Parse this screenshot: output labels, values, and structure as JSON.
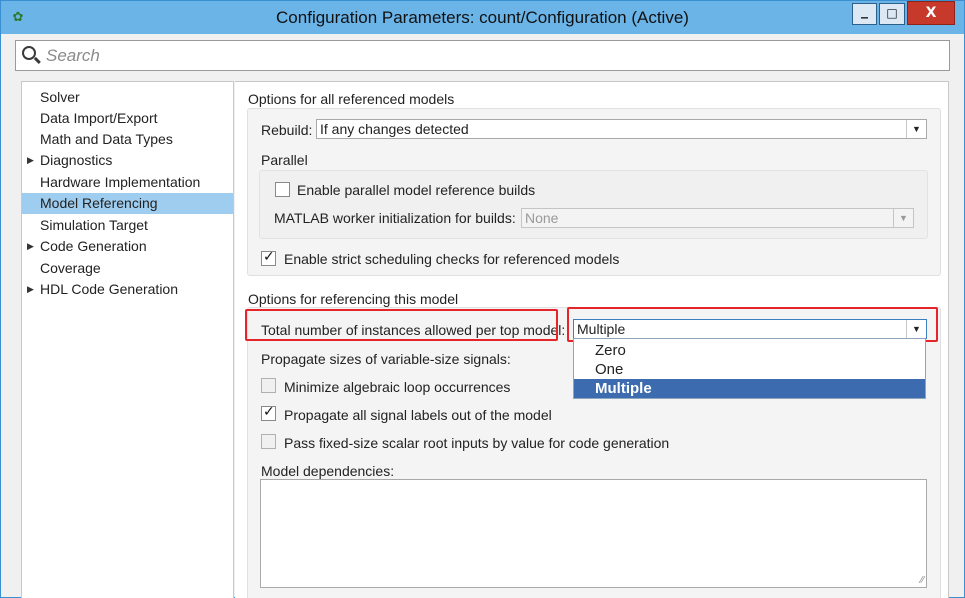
{
  "window": {
    "title": "Configuration Parameters: count/Configuration (Active)",
    "minimize_glyph": "_",
    "maximize_glyph": "□",
    "close_glyph": "X"
  },
  "search": {
    "placeholder": "Search",
    "value": ""
  },
  "sidebar": {
    "items": [
      {
        "label": "Solver",
        "expandable": false,
        "selected": false
      },
      {
        "label": "Data Import/Export",
        "expandable": false,
        "selected": false
      },
      {
        "label": "Math and Data Types",
        "expandable": false,
        "selected": false
      },
      {
        "label": "Diagnostics",
        "expandable": true,
        "selected": false
      },
      {
        "label": "Hardware Implementation",
        "expandable": false,
        "selected": false
      },
      {
        "label": "Model Referencing",
        "expandable": false,
        "selected": true
      },
      {
        "label": "Simulation Target",
        "expandable": false,
        "selected": false
      },
      {
        "label": "Code Generation",
        "expandable": true,
        "selected": false
      },
      {
        "label": "Coverage",
        "expandable": false,
        "selected": false
      },
      {
        "label": "HDL Code Generation",
        "expandable": true,
        "selected": false
      }
    ],
    "expand_glyph": "▶"
  },
  "all_models": {
    "heading": "Options for all referenced models",
    "rebuild_label": "Rebuild:",
    "rebuild_value": "If any changes detected",
    "parallel_heading": "Parallel",
    "parallel_builds_label": "Enable parallel model reference builds",
    "parallel_builds_checked": false,
    "worker_init_label": "MATLAB worker initialization for builds:",
    "worker_init_value": "None",
    "strict_scheduling_label": "Enable strict scheduling checks for referenced models",
    "strict_scheduling_checked": true
  },
  "this_model": {
    "heading": "Options for referencing this model",
    "instances_label": "Total number of instances allowed per top model:",
    "instances_value": "Multiple",
    "instances_options": [
      "Zero",
      "One",
      "Multiple"
    ],
    "propagate_sizes_label": "Propagate sizes of variable-size signals:",
    "minimize_loop_label": "Minimize algebraic loop occurrences",
    "minimize_loop_checked": false,
    "propagate_labels_label": "Propagate all signal labels out of the model",
    "propagate_labels_checked": true,
    "pass_fixed_label": "Pass fixed-size scalar root inputs by value for code generation",
    "pass_fixed_checked": false,
    "dependencies_label": "Model dependencies:",
    "dependencies_value": ""
  },
  "chevron_glyph": "▼",
  "grip_glyph": "⁄⁄",
  "colors": {
    "titlebar": "#6ab4e8",
    "selection": "#9fcdef",
    "dropdown_selected": "#3c6bb0",
    "highlight_red": "#e4262b"
  }
}
